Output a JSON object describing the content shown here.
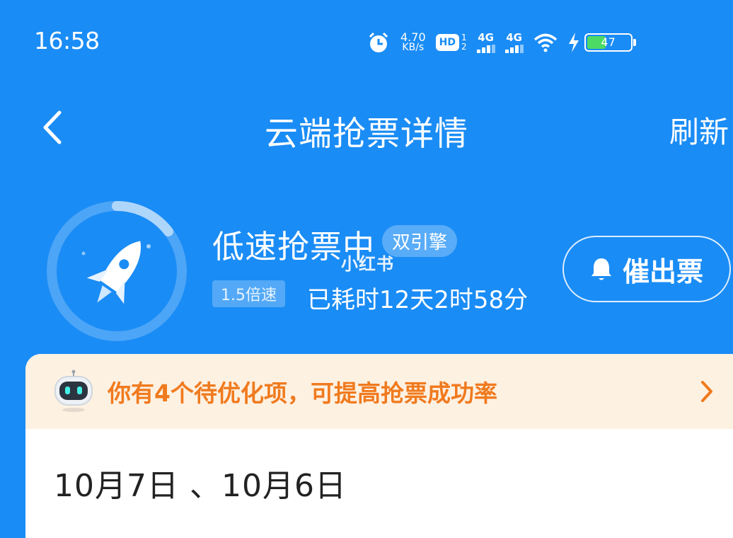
{
  "status_bar": {
    "time": "16:58",
    "net_speed_value": "4.70",
    "net_speed_unit": "KB/s",
    "hd_label": "HD",
    "sim_top": "1",
    "sim_bottom": "2",
    "signal_1": "4G",
    "signal_2": "4G",
    "battery_level": "47",
    "battery_fraction": 0.47,
    "icons": [
      "alarm-icon",
      "hd-icon",
      "signal-icon",
      "wifi-icon",
      "charging-icon",
      "battery-icon"
    ]
  },
  "nav": {
    "back_icon": "chevron-left-icon",
    "title": "云端抢票详情",
    "refresh_label": "刷新"
  },
  "grab_status": {
    "title": "低速抢票中",
    "engine_badge": "双引擎",
    "speed_badge": "1.5倍速",
    "elapsed": "已耗时12天2时58分",
    "icon": "rocket-icon",
    "urge_label": "催出票",
    "urge_icon": "bell-icon"
  },
  "watermark": "小红书",
  "tips": {
    "text": "你有4个待优化项，可提高抢票成功率",
    "icon": "robot-icon",
    "chevron": "chevron-right-icon"
  },
  "trip": {
    "dates": "10月7日 、10月6日"
  },
  "colors": {
    "primary": "#1a8cf5",
    "tips_bg": "#fdf1e2",
    "tips_text": "#f07a1e",
    "battery_fill": "#4cd964"
  }
}
